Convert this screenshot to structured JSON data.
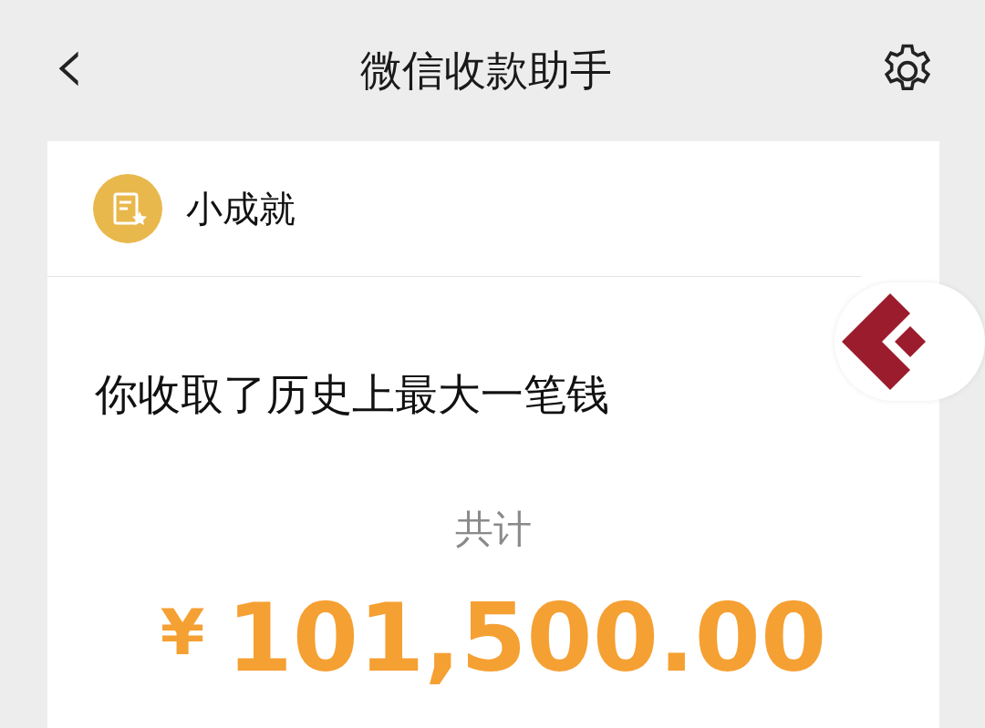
{
  "nav_bar": {
    "back_icon": "‹",
    "title": "微信收款助手"
  },
  "card": {
    "header": "小成就",
    "message": "你收取了历史上最大一笔钱",
    "total_label": "共计",
    "currency": "¥",
    "amount": "101,500.00"
  }
}
